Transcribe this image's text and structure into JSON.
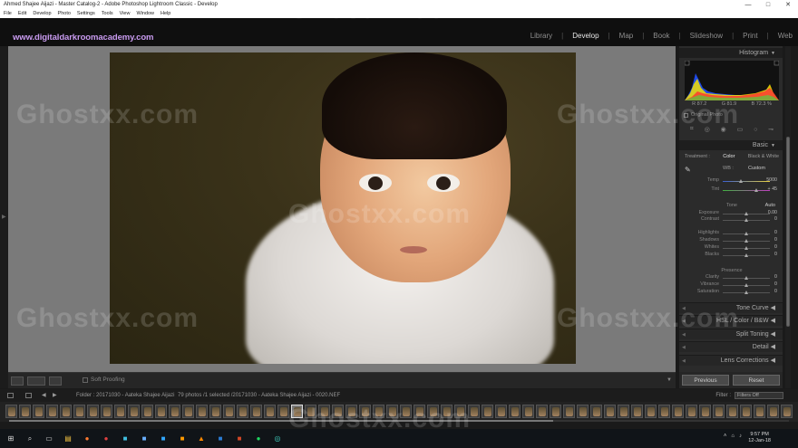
{
  "window": {
    "title": "Ahmed Shajee Aijazi - Master Catalog-2 - Adobe Photoshop Lightroom Classic - Develop",
    "controls": [
      "—",
      "□",
      "✕"
    ]
  },
  "menu": [
    "File",
    "Edit",
    "Develop",
    "Photo",
    "Settings",
    "Tools",
    "View",
    "Window",
    "Help"
  ],
  "identity_plate": "www.digitaldarkroomacademy.com",
  "modules": [
    "Library",
    "Develop",
    "Map",
    "Book",
    "Slideshow",
    "Print",
    "Web"
  ],
  "active_module": "Develop",
  "toolbar": {
    "soft_proofing": "Soft Proofing"
  },
  "histogram": {
    "title": "Histogram",
    "readout": [
      "R 87.2",
      "G 81.9",
      "B 72.3 %"
    ],
    "original_photo": "Original Photo"
  },
  "basic": {
    "title": "Basic",
    "treatment_label": "Treatment :",
    "treatment_options": [
      "Color",
      "Black & White"
    ],
    "wb_label": "WB :",
    "wb_value": "Custom",
    "tone_label": "Tone",
    "tone_auto": "Auto",
    "presence_label": "Presence",
    "sliders": [
      {
        "label": "Temp",
        "value": "5000",
        "pos": 0.4
      },
      {
        "label": "Tint",
        "value": "+ 45",
        "pos": 0.72
      },
      {
        "label": "Exposure",
        "value": "0.00",
        "pos": 0.5
      },
      {
        "label": "Contrast",
        "value": "0",
        "pos": 0.5
      },
      {
        "label": "Highlights",
        "value": "0",
        "pos": 0.5
      },
      {
        "label": "Shadows",
        "value": "0",
        "pos": 0.5
      },
      {
        "label": "Whites",
        "value": "0",
        "pos": 0.5
      },
      {
        "label": "Blacks",
        "value": "0",
        "pos": 0.5
      },
      {
        "label": "Clarity",
        "value": "0",
        "pos": 0.5
      },
      {
        "label": "Vibrance",
        "value": "0",
        "pos": 0.5
      },
      {
        "label": "Saturation",
        "value": "0",
        "pos": 0.5
      }
    ]
  },
  "sections": [
    "Tone Curve",
    "HSL / Color / B&W",
    "Split Toning",
    "Detail",
    "Lens Corrections"
  ],
  "buttons": {
    "previous": "Previous",
    "reset": "Reset"
  },
  "filmstrip": {
    "folder": "Folder : 20171030 - Aateka Shajee Aijazi",
    "count": "79 photos /1 selected /20171030 - Aateka Shajee Aijazi - 0020.NEF",
    "filter_label": "Filter :",
    "filter_value": "Filters Off"
  },
  "watermark": "Ghostxx.com",
  "clock": {
    "time": "9:57 PM",
    "date": "12-Jan-18"
  },
  "colors": {
    "identity": "#c99bf0",
    "panel": "#2b2b2b",
    "canvas": "#7a7a7a"
  }
}
